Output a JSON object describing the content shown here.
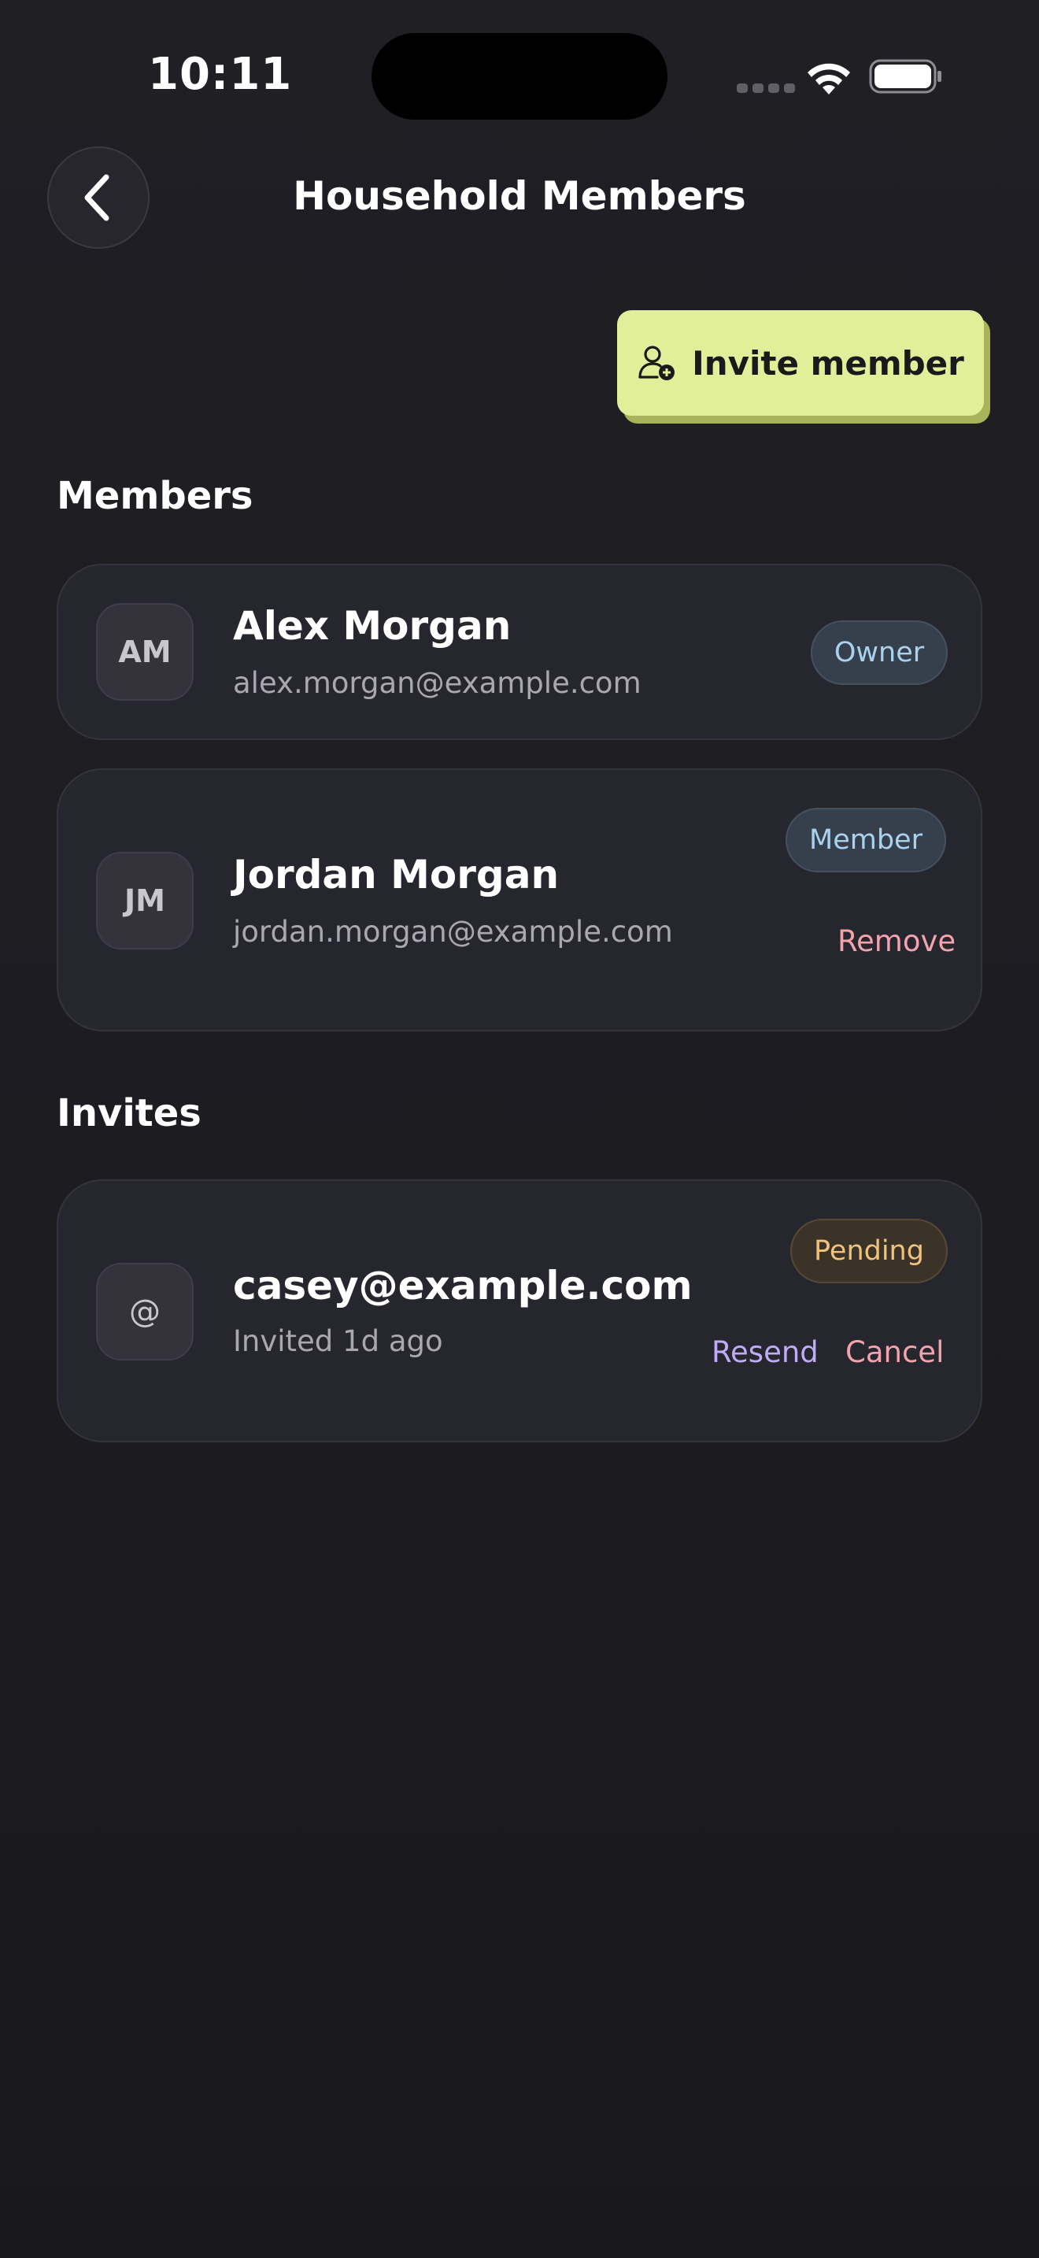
{
  "status_bar": {
    "time": "10:11"
  },
  "header": {
    "title": "Household Members"
  },
  "actions": {
    "invite_label": "Invite member"
  },
  "members_section": {
    "title": "Members",
    "items": [
      {
        "initials": "AM",
        "name": "Alex Morgan",
        "email": "alex.morgan@example.com",
        "role": "Owner"
      },
      {
        "initials": "JM",
        "name": "Jordan Morgan",
        "email": "jordan.morgan@example.com",
        "role": "Member",
        "remove_label": "Remove"
      }
    ]
  },
  "invites_section": {
    "title": "Invites",
    "items": [
      {
        "avatar_glyph": "@",
        "email": "casey@example.com",
        "invited": "Invited 1d ago",
        "status": "Pending",
        "resend_label": "Resend",
        "cancel_label": "Cancel"
      }
    ]
  },
  "colors": {
    "background": "#1f1f24",
    "card": "#26262e",
    "accent_button": "#e2ef9a",
    "badge_blue_text": "#a9d2ee",
    "badge_amber_text": "#efc27e",
    "danger": "#f2a3ac",
    "link_purple": "#c0acf6"
  },
  "icons": {
    "back": "chevron-left-icon",
    "invite": "user-plus-icon",
    "wifi": "wifi-icon",
    "battery": "battery-icon",
    "signal": "signal-icon"
  }
}
